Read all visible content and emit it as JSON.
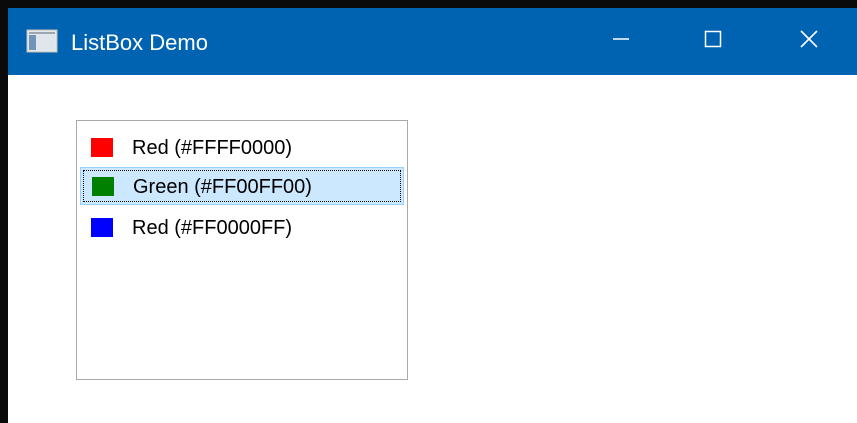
{
  "window": {
    "title": "ListBox Demo",
    "title_bar_color": "#0063b1",
    "icon": "app-window-icon",
    "controls": {
      "minimize_icon": "minimize-icon",
      "maximize_icon": "maximize-icon",
      "close_icon": "close-icon"
    }
  },
  "listbox": {
    "items": [
      {
        "label": "Red (#FFFF0000)",
        "swatch_color": "#ff0000",
        "selected": false
      },
      {
        "label": "Green (#FF00FF00)",
        "swatch_color": "#008000",
        "selected": true
      },
      {
        "label": "Red (#FF0000FF)",
        "swatch_color": "#0000ff",
        "selected": false
      }
    ],
    "selection_color": "#cce8ff"
  }
}
